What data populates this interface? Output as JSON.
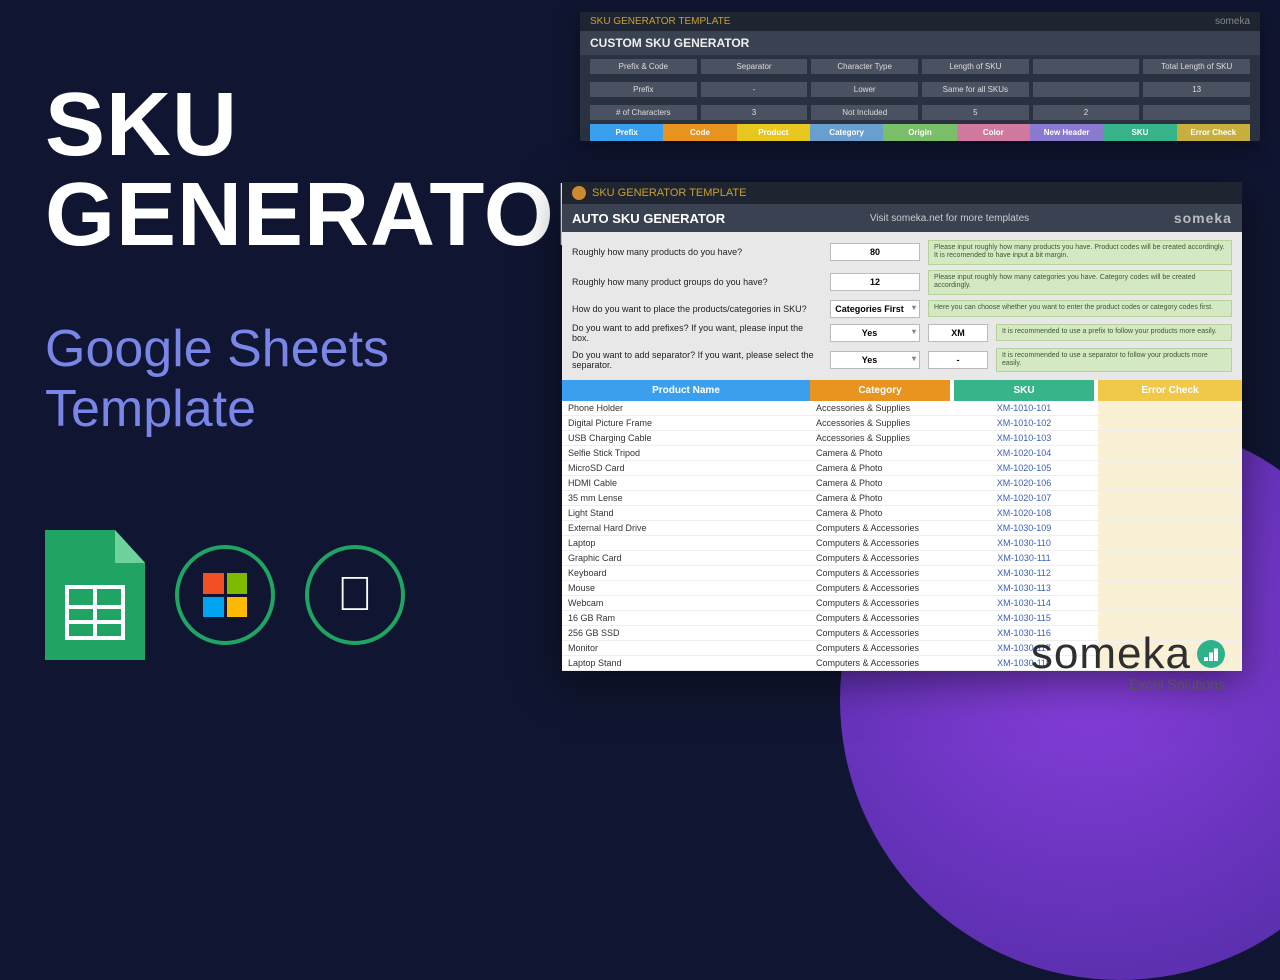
{
  "hero": {
    "title_l1": "SKU",
    "title_l2": "GENERATOR",
    "sub_l1": "Google Sheets",
    "sub_l2": "Template"
  },
  "footer": {
    "brand": "someka",
    "tagline": "Excel Solutions"
  },
  "back": {
    "top": "SKU GENERATOR TEMPLATE",
    "title": "CUSTOM SKU GENERATOR",
    "brand": "someka",
    "r1": [
      "Prefix & Code",
      "Separator",
      "Character Type",
      "Length of SKU",
      "",
      "Total Length of SKU"
    ],
    "r2": [
      "Prefix",
      "-",
      "Lower",
      "Same for all SKUs",
      "",
      "13"
    ],
    "r3": [
      "# of Characters",
      "3",
      "Not Included",
      "5",
      "2",
      ""
    ],
    "hdr": [
      "Prefix",
      "Code",
      "Product",
      "Category",
      "Origin",
      "Color",
      "New Header",
      "SKU",
      "Error Check"
    ]
  },
  "front": {
    "top": "SKU GENERATOR TEMPLATE",
    "title": "AUTO SKU GENERATOR",
    "visit": "Visit someka.net for more templates",
    "brand": "someka",
    "q": [
      {
        "label": "Roughly how many products do you have?",
        "val": "80",
        "hint": "Please input roughly how many products you have. Product codes will be created accordingly. It is recomended to have input a bit margin."
      },
      {
        "label": "Roughly how many product groups do you have?",
        "val": "12",
        "hint": "Please input roughly how many categories you have. Category codes will be created accordingly."
      },
      {
        "label": "How do you want to place the products/categories in SKU?",
        "val": "Categories First",
        "hint": "Here you can choose whether you want to enter the product codes or category codes first."
      },
      {
        "label": "Do you want to add prefixes? If you want, please input the box.",
        "val": "Yes",
        "v2": "XM",
        "hint": "It is recommended to use a prefix to follow your products more easily."
      },
      {
        "label": "Do you want to add separator? If you want, please select the separator.",
        "val": "Yes",
        "v2": "-",
        "hint": "It is recommended to use a separator to follow your products more easily."
      }
    ],
    "thead": {
      "prod": "Product Name",
      "cat": "Category",
      "sku": "SKU",
      "err": "Error Check"
    },
    "rows": [
      {
        "p": "Phone Holder",
        "c": "Accessories & Supplies",
        "s": "XM-1010-101"
      },
      {
        "p": "Digital Picture Frame",
        "c": "Accessories & Supplies",
        "s": "XM-1010-102"
      },
      {
        "p": "USB Charging Cable",
        "c": "Accessories & Supplies",
        "s": "XM-1010-103"
      },
      {
        "p": "Selfie Stick Tripod",
        "c": "Camera & Photo",
        "s": "XM-1020-104"
      },
      {
        "p": "MicroSD Card",
        "c": "Camera & Photo",
        "s": "XM-1020-105"
      },
      {
        "p": "HDMI Cable",
        "c": "Camera & Photo",
        "s": "XM-1020-106"
      },
      {
        "p": "35 mm Lense",
        "c": "Camera & Photo",
        "s": "XM-1020-107"
      },
      {
        "p": "Light Stand",
        "c": "Camera & Photo",
        "s": "XM-1020-108"
      },
      {
        "p": "External Hard Drive",
        "c": "Computers & Accessories",
        "s": "XM-1030-109"
      },
      {
        "p": "Laptop",
        "c": "Computers & Accessories",
        "s": "XM-1030-110"
      },
      {
        "p": "Graphic Card",
        "c": "Computers & Accessories",
        "s": "XM-1030-111"
      },
      {
        "p": "Keyboard",
        "c": "Computers & Accessories",
        "s": "XM-1030-112"
      },
      {
        "p": "Mouse",
        "c": "Computers & Accessories",
        "s": "XM-1030-113"
      },
      {
        "p": "Webcam",
        "c": "Computers & Accessories",
        "s": "XM-1030-114"
      },
      {
        "p": "16 GB Ram",
        "c": "Computers & Accessories",
        "s": "XM-1030-115"
      },
      {
        "p": "256 GB SSD",
        "c": "Computers & Accessories",
        "s": "XM-1030-116"
      },
      {
        "p": "Monitor",
        "c": "Computers & Accessories",
        "s": "XM-1030-117"
      },
      {
        "p": "Laptop Stand",
        "c": "Computers & Accessories",
        "s": "XM-1030-118"
      }
    ]
  }
}
